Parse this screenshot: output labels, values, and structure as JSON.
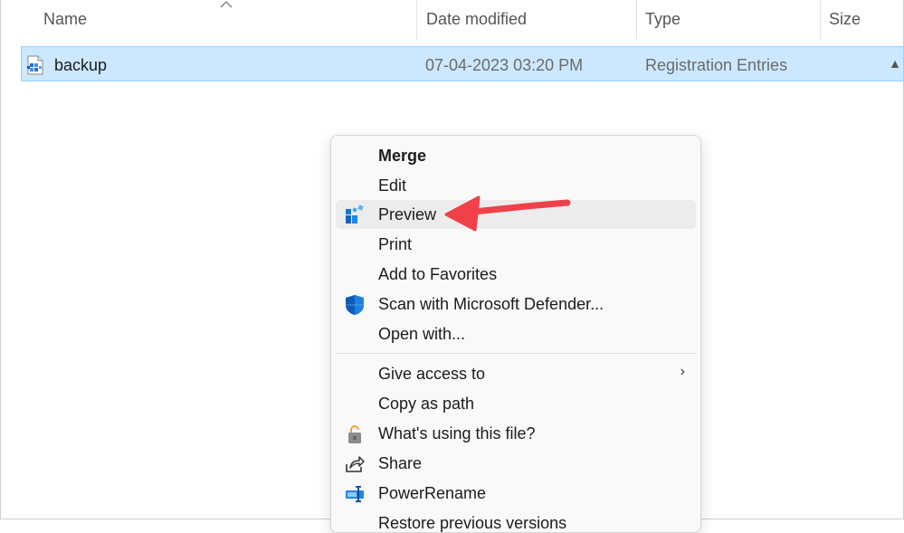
{
  "columns": {
    "name": "Name",
    "date_modified": "Date modified",
    "type": "Type",
    "size": "Size"
  },
  "file": {
    "name": "backup",
    "date_modified": "07-04-2023 03:20 PM",
    "type": "Registration Entries",
    "icon": "registry-file-icon"
  },
  "context_menu": {
    "items": [
      {
        "label": "Merge",
        "bold": true
      },
      {
        "label": "Edit"
      },
      {
        "label": "Preview",
        "icon": "preview-app-icon",
        "highlighted": true
      },
      {
        "label": "Print"
      },
      {
        "label": "Add to Favorites"
      },
      {
        "label": "Scan with Microsoft Defender...",
        "icon": "defender-shield-icon"
      },
      {
        "label": "Open with..."
      },
      {
        "label": "Give access to",
        "submenu": true
      },
      {
        "label": "Copy as path"
      },
      {
        "label": "What's using this file?",
        "icon": "lock-icon"
      },
      {
        "label": "Share",
        "icon": "share-icon"
      },
      {
        "label": "PowerRename",
        "icon": "powerrename-icon"
      },
      {
        "label": "Restore previous versions",
        "partially_visible": true
      }
    ]
  },
  "annotation": {
    "arrow_color": "#f0404a",
    "points_to": "Preview"
  },
  "colors": {
    "selection_bg": "#cce8ff",
    "selection_border": "#99d1ff",
    "menu_bg": "#f9f9f9",
    "hover_bg": "#ececec"
  }
}
